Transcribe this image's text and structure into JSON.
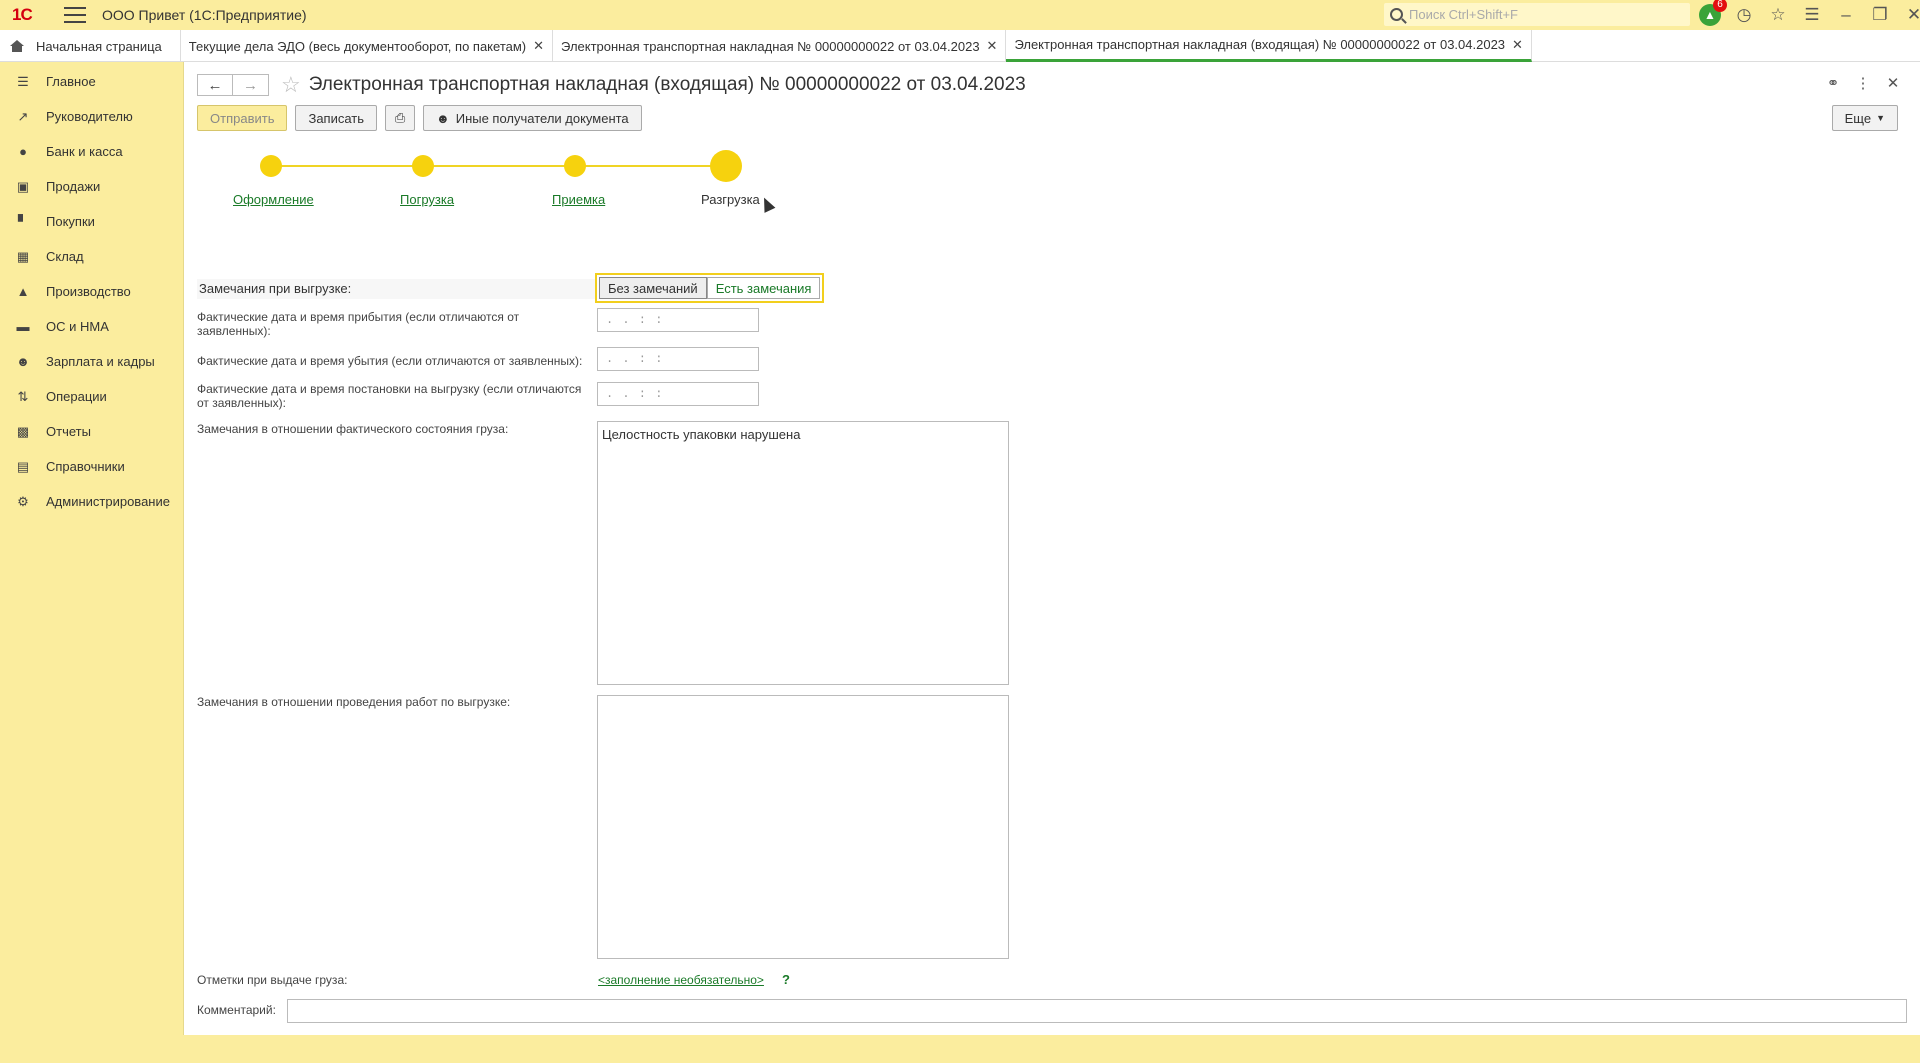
{
  "app": {
    "title": "ООО Привет  (1С:Предприятие)",
    "logo": "1С",
    "search_placeholder": "Поиск Ctrl+Shift+F",
    "notifications_count": "6"
  },
  "tabs": [
    {
      "label": "Начальная страница"
    },
    {
      "label": "Текущие дела ЭДО (весь документооборот, по пакетам)"
    },
    {
      "label": "Электронная транспортная накладная № 00000000022 от 03.04.2023"
    },
    {
      "label": "Электронная транспортная накладная (входящая) № 00000000022 от 03.04.2023"
    }
  ],
  "sidebar": {
    "items": [
      {
        "label": "Главное"
      },
      {
        "label": "Руководителю"
      },
      {
        "label": "Банк и касса"
      },
      {
        "label": "Продажи"
      },
      {
        "label": "Покупки"
      },
      {
        "label": "Склад"
      },
      {
        "label": "Производство"
      },
      {
        "label": "ОС и НМА"
      },
      {
        "label": "Зарплата и кадры"
      },
      {
        "label": "Операции"
      },
      {
        "label": "Отчеты"
      },
      {
        "label": "Справочники"
      },
      {
        "label": "Администрирование"
      }
    ]
  },
  "document": {
    "title": "Электронная транспортная накладная (входящая) № 00000000022 от 03.04.2023",
    "toolbar": {
      "send": "Отправить",
      "save": "Записать",
      "other_recipients": "Иные получатели документа",
      "more": "Еще"
    },
    "steps": [
      {
        "label": "Оформление"
      },
      {
        "label": "Погрузка"
      },
      {
        "label": "Приемка"
      },
      {
        "label": "Разгрузка"
      }
    ],
    "form": {
      "remarks_label": "Замечания при выгрузке:",
      "toggle_none": "Без замечаний",
      "toggle_has": "Есть замечания",
      "arrival_label": "Фактические дата и время прибытия (если отличаются от заявленных):",
      "departure_label": "Фактические дата и время убытия (если отличаются от заявленных):",
      "placement_label": "Фактические дата и время постановки на выгрузку (если отличаются от заявленных):",
      "date_mask": ". .     : :",
      "cargo_state_label": "Замечания в отношении фактического состояния груза:",
      "cargo_state_value": "Целостность упаковки нарушена",
      "works_label": "Замечания в отношении проведения работ по выгрузке:",
      "works_value": "",
      "issue_marks_label": "Отметки при выдаче груза:",
      "issue_marks_link": "<заполнение необязательно>",
      "help": "?",
      "comment_label": "Комментарий:",
      "comment_value": ""
    }
  }
}
